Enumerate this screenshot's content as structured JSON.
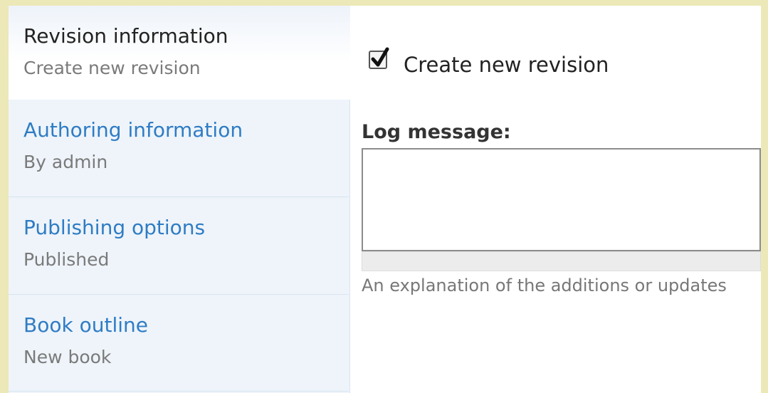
{
  "tabs": [
    {
      "title": "Revision information",
      "summary": "Create new revision",
      "active": true
    },
    {
      "title": "Authoring information",
      "summary": "By admin",
      "active": false
    },
    {
      "title": "Publishing options",
      "summary": "Published",
      "active": false
    },
    {
      "title": "Book outline",
      "summary": "New book",
      "active": false
    }
  ],
  "revision": {
    "checkbox_label": "Create new revision",
    "checked": true,
    "log_label": "Log message:",
    "log_value": "",
    "description": "An explanation of the additions or updates"
  }
}
